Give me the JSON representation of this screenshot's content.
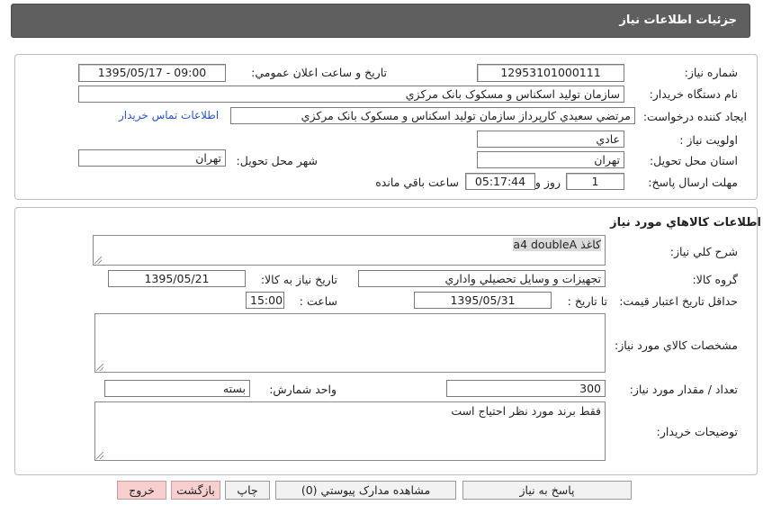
{
  "header": {
    "title": "جزئيات اطلاعات نياز"
  },
  "need_info": {
    "need_number_label": "شماره نياز:",
    "need_number": "12953101000111",
    "announce_label": "تاريخ و ساعت اعلان عمومي:",
    "announce_value": "1395/05/17 - 09:00",
    "buyer_org_label": "نام دستگاه خريدار:",
    "buyer_org": "سازمان توليد اسکناس و مسکوک بانک مرکزي",
    "requester_label": "ايجاد کننده درخواست:",
    "requester": "مرتضي سعيدي کارپرداز سازمان توليد اسکناس و مسکوک بانک مرکزي",
    "contact_link": "اطلاعات تماس خريدار",
    "priority_label": "اولويت نياز :",
    "priority": "عادي",
    "province_label": "استان محل تحويل:",
    "province": "تهران",
    "city_label": "شهر محل تحويل:",
    "city": "تهران",
    "deadline_label": "مهلت ارسال پاسخ:",
    "days_value": "1",
    "days_label": "روز و",
    "time_left": "05:17:44",
    "remaining_label": "ساعت باقي مانده"
  },
  "goods": {
    "section_title": "اطلاعات کالاهاي مورد نياز",
    "description_label": "شرح کلي نياز:",
    "description": "کاغذ a4 doubleA",
    "group_label": "گروه کالا:",
    "group_value": "تجهيزات و وسايل تحصيلي واداري",
    "need_date_label": "تاريخ نياز به کالا:",
    "need_date": "1395/05/21",
    "price_validity_label": "حداقل تاريخ اعتبار قيمت:",
    "until_date_label": "تا تاريخ :",
    "until_date": "1395/05/31",
    "hour_label": "ساعت :",
    "hour_value": "15:00",
    "specs_label": "مشخصات کالاي مورد نياز:",
    "specs_value": "",
    "quantity_label": "تعداد / مقدار مورد نياز:",
    "quantity": "300",
    "unit_label": "واحد شمارش:",
    "unit_value": "بسته",
    "buyer_notes_label": "توضيحات خريدار:",
    "buyer_notes": "فقط برند مورد نظر احتياج است"
  },
  "buttons": {
    "reply": "پاسخ به نياز",
    "attachments": "مشاهده مدارک پيوستي (0)",
    "print": "چاپ",
    "back": "بازگشت",
    "exit": "خروج"
  }
}
